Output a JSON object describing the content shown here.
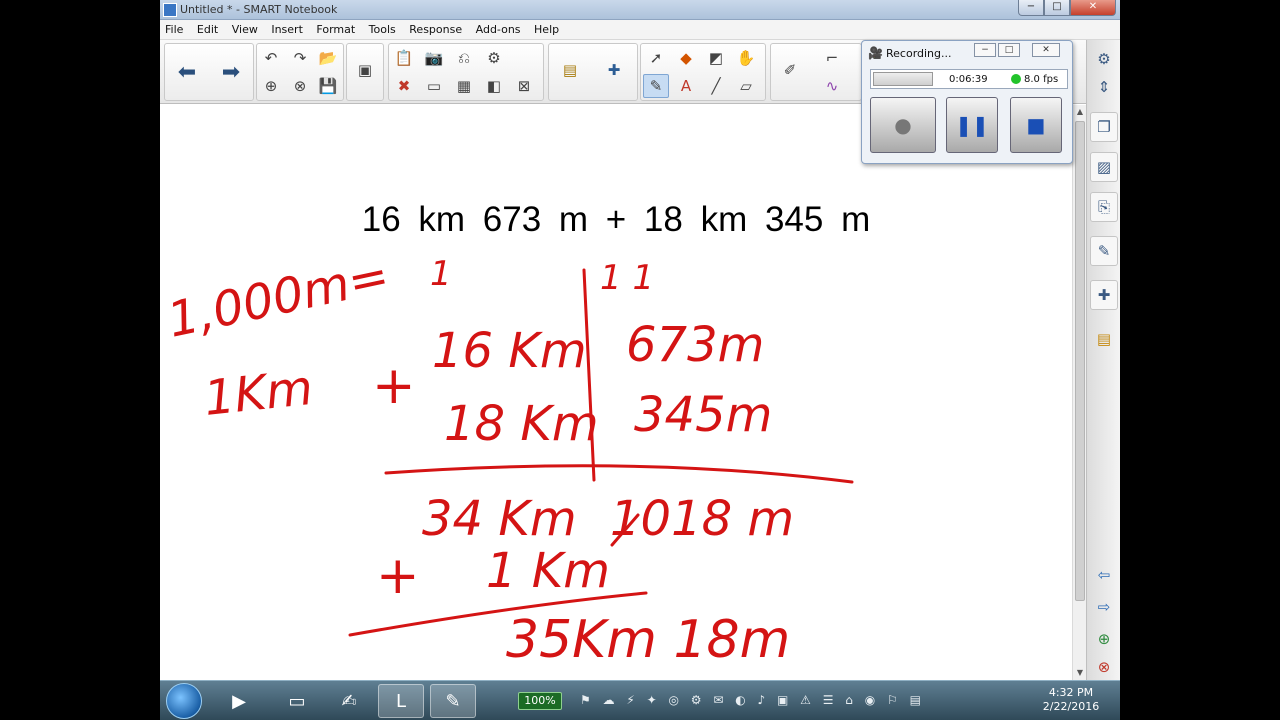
{
  "window": {
    "title": "Untitled * - SMART Notebook",
    "min": "−",
    "max": "□",
    "close": "✕"
  },
  "menu": [
    "File",
    "Edit",
    "View",
    "Insert",
    "Format",
    "Tools",
    "Response",
    "Add-ons",
    "Help"
  ],
  "problem": "16 km  673 m  +  18 km  345 m",
  "handwriting": {
    "conversion_top": "1,000m=",
    "conversion_bottom": "1Km",
    "carry_km": "1",
    "carry_m": "1 1",
    "row1_km": "16 Km",
    "row1_m": "673m",
    "row2_km": "18 Km",
    "row2_m": "345m",
    "plus1": "+",
    "sum_km": "34 Km",
    "sum_m": "1018 m",
    "plus2": "+",
    "carry_row": "1 Km",
    "result": "35Km 18m",
    "ink_color": "#d41414"
  },
  "recorder": {
    "title": "Recording...",
    "elapsed": "0:06:39",
    "fps": "8.0 fps"
  },
  "taskbar": {
    "battery": "100%",
    "time": "4:32 PM",
    "date": "2/22/2016"
  }
}
